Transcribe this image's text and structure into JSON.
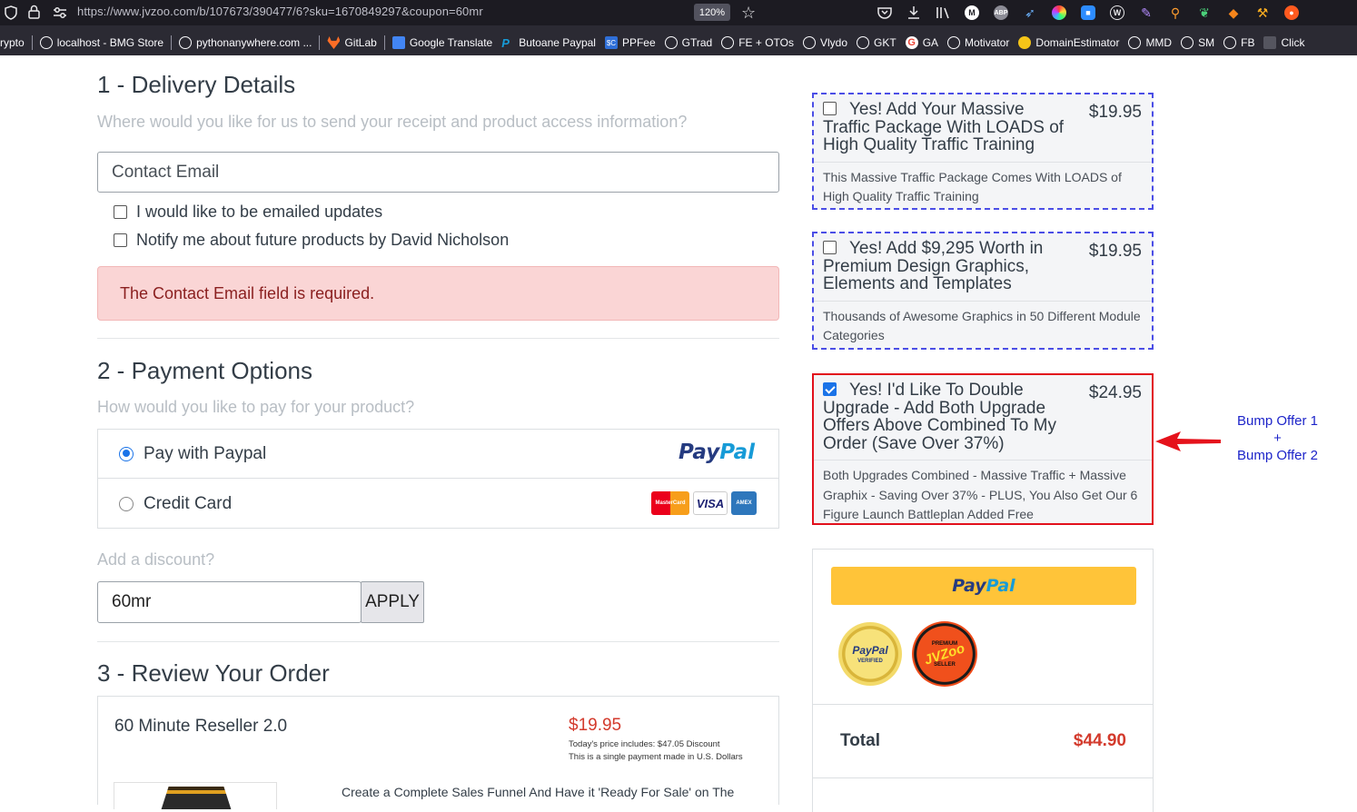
{
  "browser": {
    "url": "https://www.jvzoo.com/b/107673/390477/6?sku=1670849297&coupon=60mr",
    "zoom": "120%",
    "bookmarks": [
      {
        "label": "rypto"
      },
      {
        "label": "localhost - BMG Store"
      },
      {
        "label": "pythonanywhere.com ..."
      },
      {
        "label": "GitLab"
      },
      {
        "label": "Google Translate"
      },
      {
        "label": "Butoane Paypal"
      },
      {
        "label": "PPFee"
      },
      {
        "label": "GTrad"
      },
      {
        "label": "FE + OTOs"
      },
      {
        "label": "Vlydo"
      },
      {
        "label": "GKT"
      },
      {
        "label": "GA"
      },
      {
        "label": "Motivator"
      },
      {
        "label": "DomainEstimator"
      },
      {
        "label": "MMD"
      },
      {
        "label": "SM"
      },
      {
        "label": "FB"
      },
      {
        "label": "Click"
      }
    ]
  },
  "delivery": {
    "title": "1 - Delivery Details",
    "subtitle": "Where would you like for us to send your receipt and product access information?",
    "email_placeholder": "Contact Email",
    "opt_updates": "I would like to be emailed updates",
    "opt_notify": "Notify me about future products by David Nicholson",
    "error": "The Contact Email field is required."
  },
  "payment": {
    "title": "2 - Payment Options",
    "subtitle": "How would you like to pay for your product?",
    "option_paypal": "Pay with Paypal",
    "option_card": "Credit Card",
    "paypal_logo_a": "Pay",
    "paypal_logo_b": "Pal",
    "card_logos": [
      "MasterCard",
      "VISA",
      "AMEX"
    ],
    "discount_label": "Add a discount?",
    "discount_value": "60mr",
    "apply_label": "APPLY"
  },
  "review": {
    "title": "3 - Review Your Order",
    "product_name": "60 Minute Reseller 2.0",
    "price": "$19.95",
    "price_note_1": "Today's price includes: $47.05 Discount",
    "price_note_2": "This is a single payment made in U.S. Dollars",
    "description": "Create a Complete Sales Funnel And Have it 'Ready For Sale' on The"
  },
  "bumps": [
    {
      "title": "Yes! Add Your Massive Traffic Package With LOADS of High Quality Traffic Training",
      "price": "$19.95",
      "description": "This Massive Traffic Package Comes With LOADS of High Quality Traffic Training",
      "checked": false
    },
    {
      "title": "Yes! Add $9,295 Worth in Premium Design Graphics, Elements and Templates",
      "price": "$19.95",
      "description": "Thousands of Awesome Graphics in 50 Different Module Categories",
      "checked": false
    },
    {
      "title": "Yes! I'd Like To Double Upgrade - Add Both Upgrade Offers Above Combined To My Order (Save Over 37%)",
      "price": "$24.95",
      "description": "Both Upgrades Combined - Massive Traffic + Massive Graphix - Saving Over 37% - PLUS, You Also Get Our 6 Figure Launch Battleplan Added Free",
      "checked": true
    }
  ],
  "checkout": {
    "paypal_a": "Pay",
    "paypal_b": "Pal",
    "seal_paypal_a": "PayPal",
    "seal_paypal_b": "VERIFIED",
    "seal_jvzoo_top": "PREMIUM",
    "seal_jvzoo_mid": "JVZoo",
    "seal_jvzoo_bottom": "SELLER",
    "total_label": "Total",
    "total_value": "$44.90"
  },
  "annotation": {
    "line1": "Bump Offer 1",
    "line2": "+",
    "line3": "Bump Offer 2"
  },
  "colors": {
    "accent_blue": "#1a73e8",
    "error_bg": "#fad5d5",
    "price_red": "#d33a2c",
    "bump_dash": "#4b4ee6",
    "bump_active": "#e2101c",
    "annotation_blue": "#1d24c9"
  }
}
